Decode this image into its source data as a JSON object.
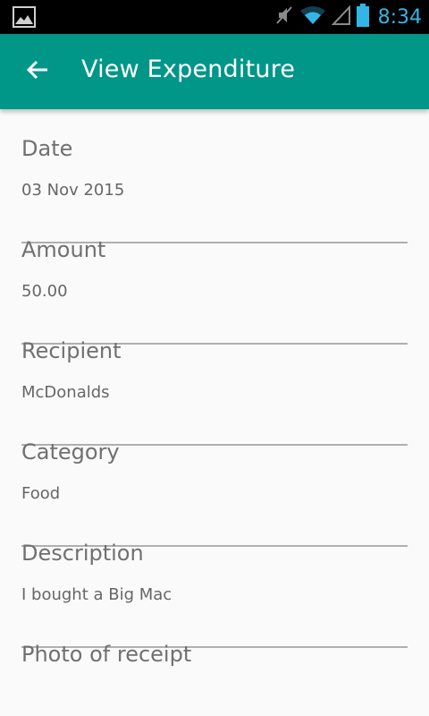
{
  "status_bar": {
    "time": "8:34",
    "icons": [
      "image-icon",
      "mute-icon",
      "wifi-icon",
      "signal-icon",
      "battery-icon"
    ]
  },
  "app_bar": {
    "title": "View Expenditure",
    "back_icon": "arrow-back-icon",
    "color": "#009688"
  },
  "fields": {
    "date": {
      "label": "Date",
      "value": "03 Nov 2015"
    },
    "amount": {
      "label": "Amount",
      "value": "50.00"
    },
    "recipient": {
      "label": "Recipient",
      "value": "McDonalds"
    },
    "category": {
      "label": "Category",
      "value": "Food"
    },
    "description": {
      "label": "Description",
      "value": "I bought a Big Mac"
    },
    "photo": {
      "label": "Photo of receipt"
    }
  }
}
